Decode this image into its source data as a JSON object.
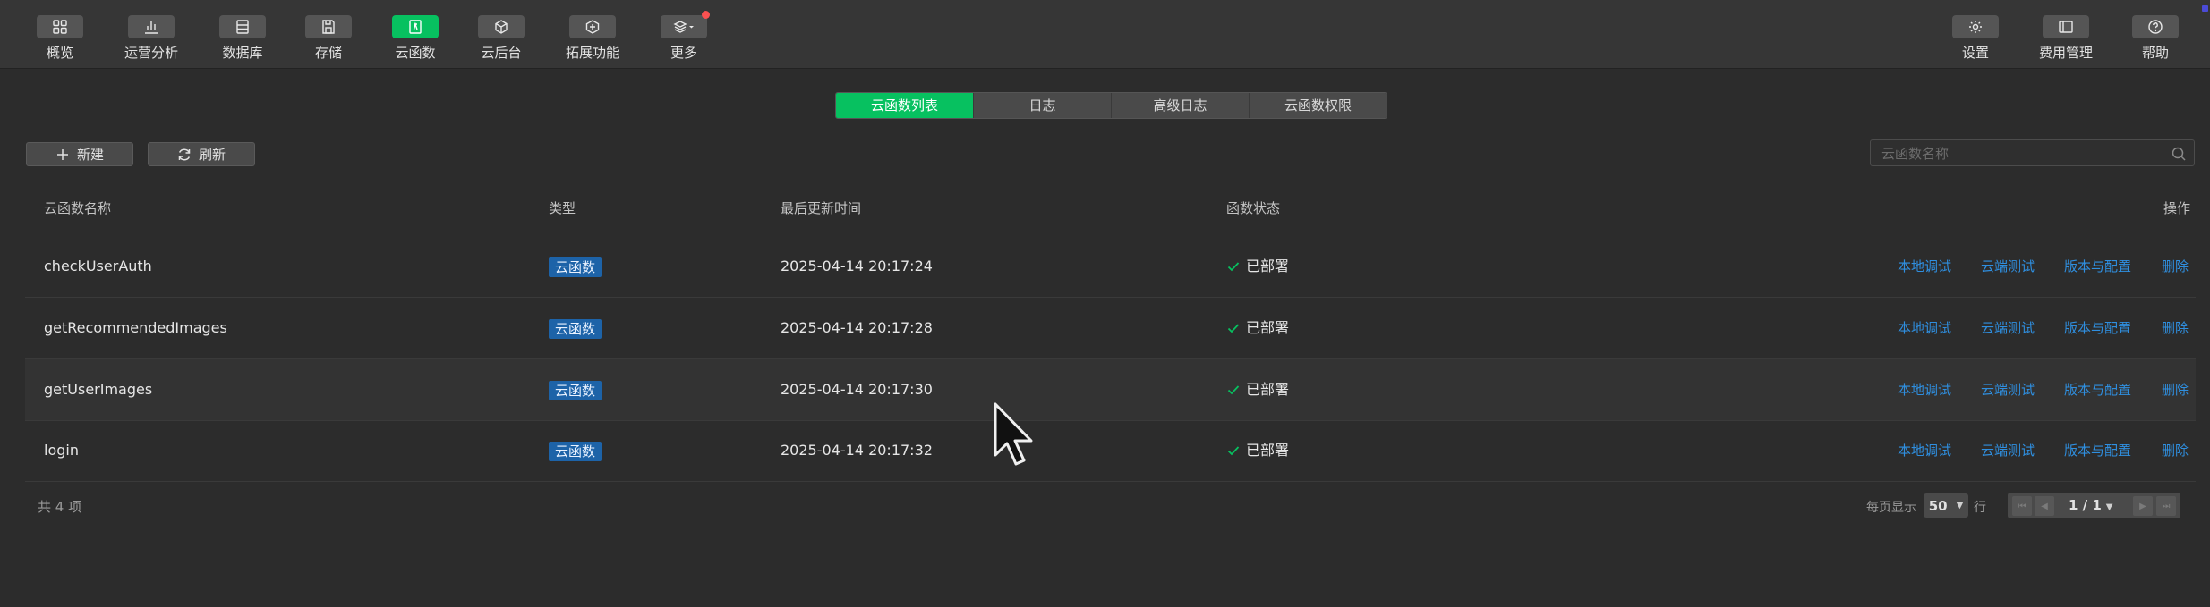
{
  "toolbar": {
    "left": [
      {
        "label": "概览",
        "icon": "grid-icon"
      },
      {
        "label": "运营分析",
        "icon": "bar-chart-icon"
      },
      {
        "label": "数据库",
        "icon": "database-icon"
      },
      {
        "label": "存储",
        "icon": "storage-icon"
      },
      {
        "label": "云函数",
        "icon": "cloud-function-icon",
        "active": true
      },
      {
        "label": "云后台",
        "icon": "cube-icon"
      },
      {
        "label": "拓展功能",
        "icon": "extension-icon"
      },
      {
        "label": "更多",
        "icon": "layers-icon",
        "badge": true
      }
    ],
    "right": [
      {
        "label": "设置",
        "icon": "gear-icon"
      },
      {
        "label": "费用管理",
        "icon": "billing-icon"
      },
      {
        "label": "帮助",
        "icon": "help-icon"
      }
    ]
  },
  "tabs": [
    {
      "label": "云函数列表",
      "active": true
    },
    {
      "label": "日志"
    },
    {
      "label": "高级日志"
    },
    {
      "label": "云函数权限"
    }
  ],
  "actions": {
    "new_label": "新建",
    "refresh_label": "刷新"
  },
  "search": {
    "placeholder": "云函数名称"
  },
  "table": {
    "columns": {
      "name": "云函数名称",
      "type": "类型",
      "updated": "最后更新时间",
      "status": "函数状态",
      "ops": "操作"
    },
    "rows": [
      {
        "name": "checkUserAuth",
        "type": "云函数",
        "updated": "2025-04-14 20:17:24",
        "status": "已部署"
      },
      {
        "name": "getRecommendedImages",
        "type": "云函数",
        "updated": "2025-04-14 20:17:28",
        "status": "已部署"
      },
      {
        "name": "getUserImages",
        "type": "云函数",
        "updated": "2025-04-14 20:17:30",
        "status": "已部署"
      },
      {
        "name": "login",
        "type": "云函数",
        "updated": "2025-04-14 20:17:32",
        "status": "已部署"
      }
    ],
    "row_actions": {
      "local_debug": "本地调试",
      "cloud_test": "云端测试",
      "version_config": "版本与配置",
      "delete": "删除"
    }
  },
  "footer": {
    "total": "共 4 项",
    "per_page_label": "每页显示",
    "per_page_value": "50",
    "per_page_unit": "行",
    "page_indicator": "1 / 1"
  },
  "colors": {
    "accent": "#07c160",
    "link": "#2f8fe0",
    "badge": "#1d63a8",
    "success": "#07c160",
    "background": "#2c2c2c"
  }
}
